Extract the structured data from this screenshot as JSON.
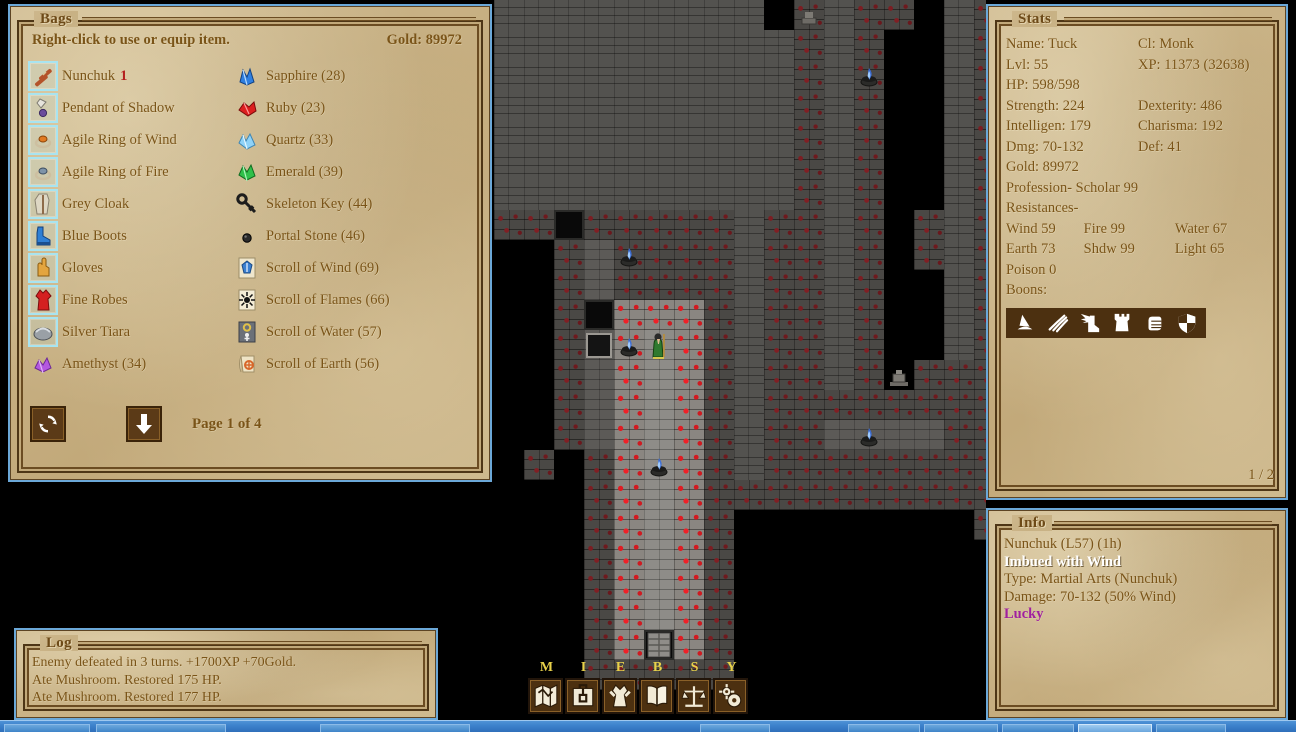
{
  "bags": {
    "title": "Bags",
    "hint": "Right-click to use or equip item.",
    "gold_label": "Gold: 89972",
    "page_label": "Page 1 of 4",
    "refresh_icon": "refresh-icon",
    "down_icon": "arrow-down-icon",
    "left_items": [
      {
        "icon": "nunchuk-icon",
        "label": "Nunchuk",
        "qty": "1",
        "equipped": true,
        "qty_red": true
      },
      {
        "icon": "pendant-icon",
        "label": "Pendant of Shadow",
        "qty": "",
        "equipped": true,
        "qty_red": false
      },
      {
        "icon": "ring-fire-icon",
        "label": "Agile Ring of Wind",
        "qty": "",
        "equipped": true,
        "qty_red": false
      },
      {
        "icon": "ring-grey-icon",
        "label": "Agile Ring of Fire",
        "qty": "",
        "equipped": true,
        "qty_red": false
      },
      {
        "icon": "cloak-icon",
        "label": "Grey Cloak",
        "qty": "",
        "equipped": true,
        "qty_red": false
      },
      {
        "icon": "boots-icon",
        "label": "Blue Boots",
        "qty": "",
        "equipped": true,
        "qty_red": false
      },
      {
        "icon": "gloves-icon",
        "label": "Gloves",
        "qty": "",
        "equipped": true,
        "qty_red": false
      },
      {
        "icon": "robes-icon",
        "label": "Fine Robes",
        "qty": "",
        "equipped": true,
        "qty_red": false
      },
      {
        "icon": "tiara-icon",
        "label": "Silver Tiara",
        "qty": "",
        "equipped": true,
        "qty_red": false
      },
      {
        "icon": "amethyst-icon",
        "label": "Amethyst (34)",
        "qty": "",
        "equipped": false,
        "qty_red": false
      }
    ],
    "right_items": [
      {
        "icon": "sapphire-icon",
        "label": "Sapphire (28)",
        "equipped": false
      },
      {
        "icon": "ruby-icon",
        "label": "Ruby (23)",
        "equipped": false
      },
      {
        "icon": "quartz-icon",
        "label": "Quartz (33)",
        "equipped": false
      },
      {
        "icon": "emerald-icon",
        "label": "Emerald (39)",
        "equipped": false
      },
      {
        "icon": "skeleton-key-icon",
        "label": "Skeleton Key (44)",
        "equipped": false
      },
      {
        "icon": "portal-stone-icon",
        "label": "Portal Stone (46)",
        "equipped": false
      },
      {
        "icon": "scroll-wind-icon",
        "label": "Scroll of Wind (69)",
        "equipped": false
      },
      {
        "icon": "scroll-flames-icon",
        "label": "Scroll of Flames (66)",
        "equipped": false
      },
      {
        "icon": "scroll-water-icon",
        "label": "Scroll of Water (57)",
        "equipped": false
      },
      {
        "icon": "scroll-earth-icon",
        "label": "Scroll of Earth (56)",
        "equipped": false
      }
    ]
  },
  "stats": {
    "title": "Stats",
    "name_label": "Name: Tuck",
    "class_label": "Cl: Monk",
    "lvl_label": "Lvl: 55",
    "xp_label": "XP: 11373 (32638)",
    "hp_label": "HP: 598/598",
    "strength_label": "Strength: 224",
    "dexterity_label": "Dexterity: 486",
    "intelligence_label": "Intelligen: 179",
    "charisma_label": "Charisma: 192",
    "dmg_label": "Dmg: 70-132",
    "def_label": "Def: 41",
    "gold_label": "Gold: 89972",
    "profession_label": "Profession- Scholar 99",
    "resistances_label": "Resistances-",
    "res_wind": "Wind  59",
    "res_fire": "Fire  99",
    "res_water": "Water 67",
    "res_earth": "Earth  73",
    "res_shdw": "Shdw  99",
    "res_light": "Light 65",
    "res_poison": "Poison 0",
    "boons_label": "Boons:",
    "boons": [
      "wizard-hat-icon",
      "claw-slash-icon",
      "winged-boot-icon",
      "tower-rook-icon",
      "fist-icon",
      "shield-icon"
    ],
    "page_indicator": "1 / 2"
  },
  "info": {
    "title": "Info",
    "lines": [
      {
        "text": "Nunchuk (L57) (1h)",
        "style": "base"
      },
      {
        "text": "Imbued with Wind",
        "style": "white"
      },
      {
        "text": "Type: Martial Arts (Nunchuk)",
        "style": "base"
      },
      {
        "text": "Damage: 70-132 (50% Wind)",
        "style": "base"
      },
      {
        "text": "Lucky",
        "style": "purple"
      }
    ]
  },
  "log": {
    "title": "Log",
    "lines": [
      "Enemy defeated in 3 turns. +1700XP +70Gold.",
      "Ate Mushroom. Restored 175 HP.",
      "Ate Mushroom. Restored 177 HP."
    ]
  },
  "hotbar": {
    "buttons": [
      {
        "key": "M",
        "icon": "map-icon"
      },
      {
        "key": "I",
        "icon": "inventory-icon"
      },
      {
        "key": "E",
        "icon": "equipment-icon"
      },
      {
        "key": "B",
        "icon": "book-icon"
      },
      {
        "key": "S",
        "icon": "scales-icon"
      },
      {
        "key": "Y",
        "icon": "gears-icon"
      }
    ]
  },
  "colors": {
    "parchment": "#c9b386",
    "ink": "#7a5418",
    "border_dark": "#4e3616",
    "accent_blue": "#6ba8d8",
    "equipped_border": "#a8e4f0",
    "qty_red": "#b42020",
    "hotkey_yellow": "#e8d14a",
    "imbue_white": "#ffffff",
    "lucky_purple": "#a0209e",
    "boon_strip_bg": "#4c3010"
  }
}
